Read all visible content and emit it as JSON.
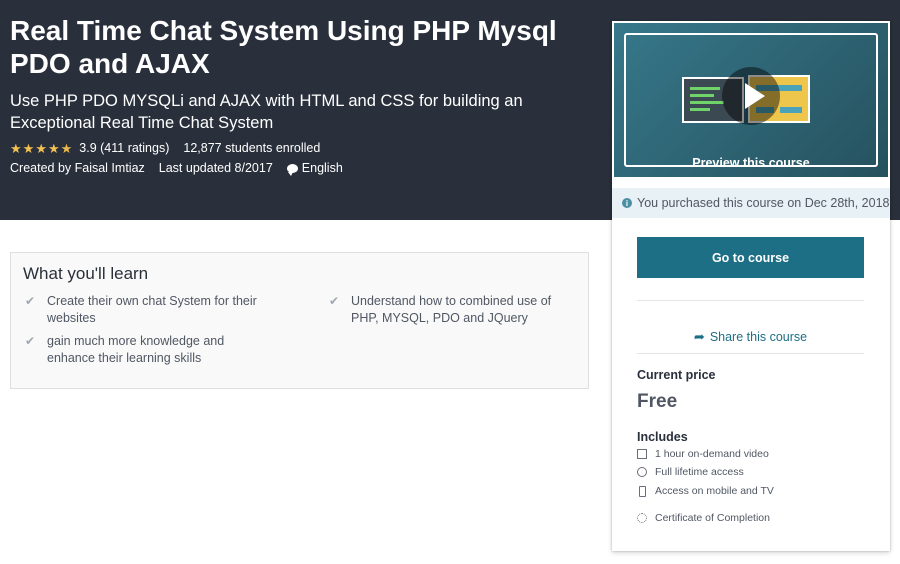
{
  "course": {
    "title": "Real Time Chat System Using PHP Mysql PDO and AJAX",
    "subtitle": "Use PHP PDO MYSQLi and AJAX with HTML and CSS for building an Exceptional Real Time Chat System",
    "rating_value": 3.9,
    "rating_text": "3.9 (411 ratings)",
    "enrolled": "12,877 students enrolled",
    "created_by": "Created by Faisal Imtiaz",
    "last_updated": "Last updated 8/2017",
    "language": "English",
    "stars": "★★★★★"
  },
  "learn": {
    "heading": "What you'll learn",
    "items": [
      "Create their own chat System for their websites",
      "Understand how to combined use of PHP, MYSQL, PDO and JQuery",
      "gain much more knowledge and enhance their learning skills"
    ],
    "icon": "check-icon"
  },
  "sidebar": {
    "preview_caption": "Preview this course",
    "purchase_notice": "You purchased this course on Dec 28th, 2018",
    "go_button": "Go to course",
    "share": "Share this course",
    "price_label": "Current price",
    "price": "Free",
    "includes_label": "Includes",
    "includes": [
      {
        "icon": "video-icon",
        "text": "1 hour on-demand video"
      },
      {
        "icon": "infinity-icon",
        "text": "Full lifetime access"
      },
      {
        "icon": "mobile-icon",
        "text": "Access on mobile and TV"
      },
      {
        "icon": "certificate-icon",
        "text": "Certificate of Completion"
      }
    ]
  },
  "colors": {
    "hero_bg": "#29303b",
    "star": "#f4c150",
    "accent": "#1d6f86",
    "notice_bg": "#e8f1f5"
  }
}
